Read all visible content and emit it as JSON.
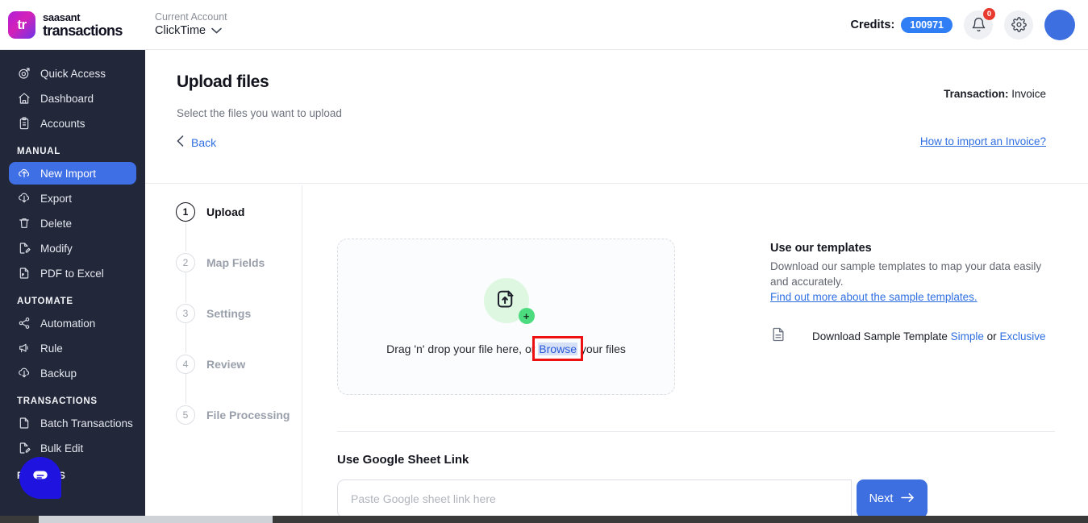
{
  "header": {
    "logo_text": "tr",
    "brand_top": "saasant",
    "brand_bottom": "transactions",
    "account_label": "Current Account",
    "account_name": "ClickTime",
    "account_chevron": "chevron-down-icon",
    "credits_label": "Credits:",
    "credits_value": "100971",
    "notification_badge": "0",
    "accent_blue": "#2f7ef5"
  },
  "sidebar": {
    "items": [
      {
        "label": "Quick Access",
        "icon": "target-icon",
        "active": false
      },
      {
        "label": "Dashboard",
        "icon": "home-icon",
        "active": false
      },
      {
        "label": "Accounts",
        "icon": "clipboard-icon",
        "active": false
      }
    ],
    "sections": [
      {
        "title": "MANUAL",
        "items": [
          {
            "label": "New Import",
            "icon": "cloud-upload-icon",
            "active": true
          },
          {
            "label": "Export",
            "icon": "cloud-download-icon",
            "active": false
          },
          {
            "label": "Delete",
            "icon": "trash-icon",
            "active": false
          },
          {
            "label": "Modify",
            "icon": "file-edit-icon",
            "active": false
          },
          {
            "label": "PDF to Excel",
            "icon": "pdf-file-icon",
            "active": false
          }
        ]
      },
      {
        "title": "AUTOMATE",
        "items": [
          {
            "label": "Automation",
            "icon": "share-nodes-icon",
            "active": false
          },
          {
            "label": "Rule",
            "icon": "megaphone-icon",
            "active": false
          },
          {
            "label": "Backup",
            "icon": "cloud-download-icon",
            "active": false
          }
        ]
      },
      {
        "title": "TRANSACTIONS",
        "items": [
          {
            "label": "Batch Transactions",
            "icon": "document-icon",
            "active": false
          },
          {
            "label": "Bulk Edit",
            "icon": "document-edit-icon",
            "active": false
          }
        ]
      },
      {
        "title": "REPORTS",
        "items": []
      }
    ],
    "active_bg": "#3f6fe4",
    "bg": "#22273a"
  },
  "main": {
    "page_title": "Upload files",
    "page_subtitle": "Select the files you want to upload",
    "back_label": "Back",
    "transaction_label": "Transaction:",
    "transaction_value": "Invoice",
    "howto_link": "How to import an Invoice?",
    "steps": [
      {
        "number": "1",
        "label": "Upload",
        "current": true
      },
      {
        "number": "2",
        "label": "Map Fields",
        "current": false
      },
      {
        "number": "3",
        "label": "Settings",
        "current": false
      },
      {
        "number": "4",
        "label": "Review",
        "current": false
      },
      {
        "number": "5",
        "label": "File Processing",
        "current": false
      }
    ],
    "dropzone": {
      "icon": "file-upload-icon",
      "plus_badge": "+",
      "text_before": "Drag 'n' drop your file here, or",
      "browse_label": "Browse",
      "text_after": "your files",
      "highlight_color": "#ee1111"
    },
    "templates": {
      "title": "Use our templates",
      "description": "Download our sample templates to map your data easily and accurately.",
      "find_out_link": "Find out more about the sample templates.",
      "download_icon": "document-icon",
      "download_text": "Download Sample Template",
      "option_simple": "Simple",
      "option_or": "or",
      "option_exclusive": "Exclusive"
    },
    "google_sheet": {
      "title": "Use Google Sheet Link",
      "input_value": "",
      "placeholder": "Paste Google sheet link here",
      "next_label": "Next",
      "next_icon": "arrow-right-icon"
    }
  },
  "chat_widget": {
    "icon": "chat-bubble-icon",
    "color": "#1f13e0"
  }
}
